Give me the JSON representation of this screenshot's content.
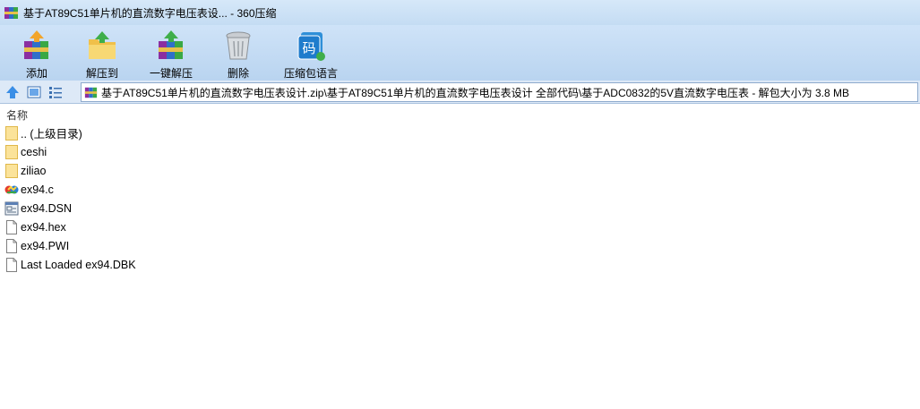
{
  "window": {
    "title": "基于AT89C51单片机的直流数字电压表设... - 360压缩",
    "app_icon": "winrar-books-icon"
  },
  "toolbar": {
    "items": [
      {
        "label": "添加",
        "icon": "add-archive-icon"
      },
      {
        "label": "解压到",
        "icon": "extract-to-icon"
      },
      {
        "label": "一键解压",
        "icon": "one-click-extract-icon"
      },
      {
        "label": "删除",
        "icon": "trash-icon"
      },
      {
        "label": "压缩包语言",
        "icon": "language-code-icon"
      }
    ]
  },
  "address": {
    "path": "基于AT89C51单片机的直流数字电压表设计.zip\\基于AT89C51单片机的直流数字电压表设计 全部代码\\基于ADC0832的5V直流数字电压表 - 解包大小为 3.8 MB"
  },
  "file_list": {
    "column_header": "名称",
    "rows": [
      {
        "name": ".. (上级目录)",
        "type": "folder"
      },
      {
        "name": "ceshi",
        "type": "folder"
      },
      {
        "name": "ziliao",
        "type": "folder"
      },
      {
        "name": "ex94.c",
        "type": "c-source"
      },
      {
        "name": "ex94.DSN",
        "type": "dsn"
      },
      {
        "name": "ex94.hex",
        "type": "file"
      },
      {
        "name": "ex94.PWI",
        "type": "file"
      },
      {
        "name": "Last Loaded ex94.DBK",
        "type": "file"
      }
    ]
  },
  "colors": {
    "toolbar_bg": "#c4dcf3",
    "address_bg": "#dde9f7",
    "folder": "#f5d36a"
  }
}
